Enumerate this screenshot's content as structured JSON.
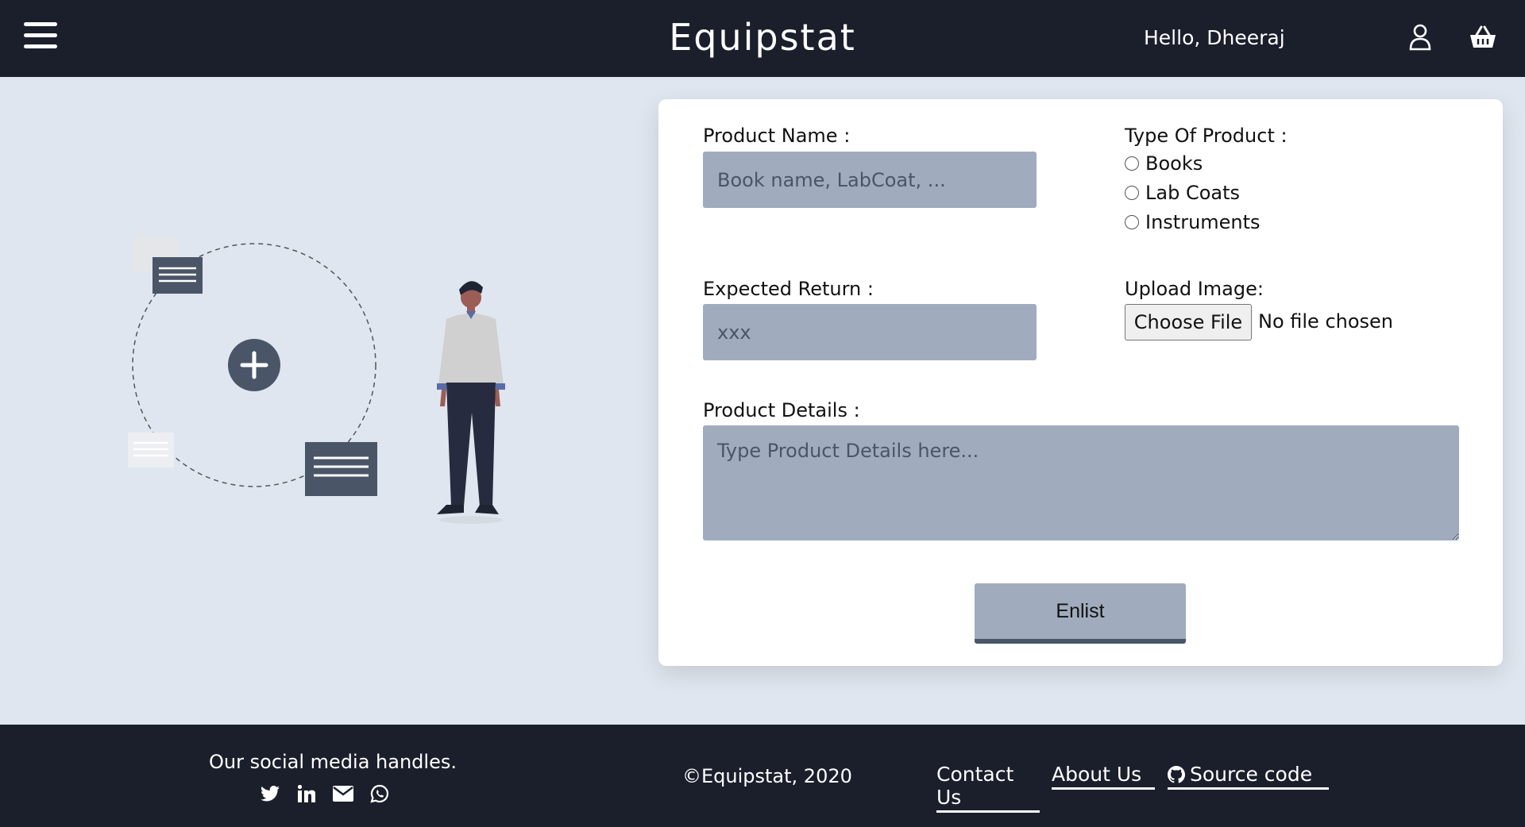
{
  "header": {
    "brand": "Equipstat",
    "greeting": "Hello, Dheeraj",
    "icons": [
      "hamburger-icon",
      "user-icon",
      "shopping-basket-icon"
    ]
  },
  "form": {
    "product_name_label": "Product Name :",
    "product_name_placeholder": "Book name, LabCoat, ...",
    "product_name_value": "",
    "type_label": "Type Of Product :",
    "type_options": [
      "Books",
      "Lab Coats",
      "Instruments"
    ],
    "expected_return_label": "Expected Return :",
    "expected_return_placeholder": "xxx",
    "expected_return_value": "",
    "upload_label": "Upload Image:",
    "choose_file_label": "Choose File",
    "no_file_text": "No file chosen",
    "details_label": "Product Details :",
    "details_placeholder": "Type Product Details here...",
    "details_value": "",
    "submit_label": "Enlist"
  },
  "footer": {
    "social_heading": "Our social media handles.",
    "social_icons": [
      "twitter-icon",
      "linkedin-icon",
      "email-icon",
      "whatsapp-icon"
    ],
    "copyright": "©Equipstat, 2020",
    "links": {
      "contact": "Contact Us",
      "about": "About Us",
      "source": "Source code"
    }
  },
  "colors": {
    "nav_bg": "#1b1f2c",
    "page_bg": "#e0e6ef",
    "input_bg": "#a0acbe",
    "accent_dark": "#4a5568"
  }
}
